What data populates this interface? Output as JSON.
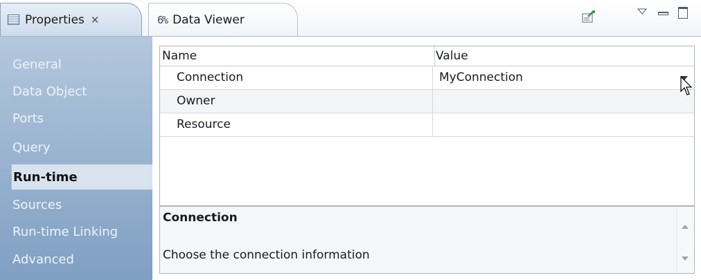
{
  "tabs": [
    {
      "label": "Properties",
      "icon": "properties-icon",
      "close": "✕",
      "active": true
    },
    {
      "label": "Data Viewer",
      "icon": "data-viewer-icon",
      "active": false
    }
  ],
  "toolbar": {
    "pin": "pin-icon",
    "menu": "view-menu-icon",
    "minimize": "minimize-icon",
    "maximize": "maximize-icon"
  },
  "nav": {
    "items": [
      {
        "label": "General"
      },
      {
        "label": "Data Object"
      },
      {
        "label": "Ports"
      },
      {
        "label": "Query"
      },
      {
        "label": "Run-time",
        "selected": true
      },
      {
        "label": "Sources"
      },
      {
        "label": "Run-time Linking"
      },
      {
        "label": "Advanced"
      }
    ]
  },
  "table": {
    "headers": {
      "name": "Name",
      "value": "Value"
    },
    "rows": [
      {
        "name": "Connection",
        "value": "MyConnection"
      },
      {
        "name": "Owner",
        "value": ""
      },
      {
        "name": "Resource",
        "value": ""
      }
    ]
  },
  "description": {
    "title": "Connection",
    "text": "Choose the connection information"
  },
  "colors": {
    "nav_top": "#b3c7dd",
    "nav_bottom": "#7f9fc2",
    "selected_bg": "#d9e3ee",
    "border": "#aab4bf"
  }
}
